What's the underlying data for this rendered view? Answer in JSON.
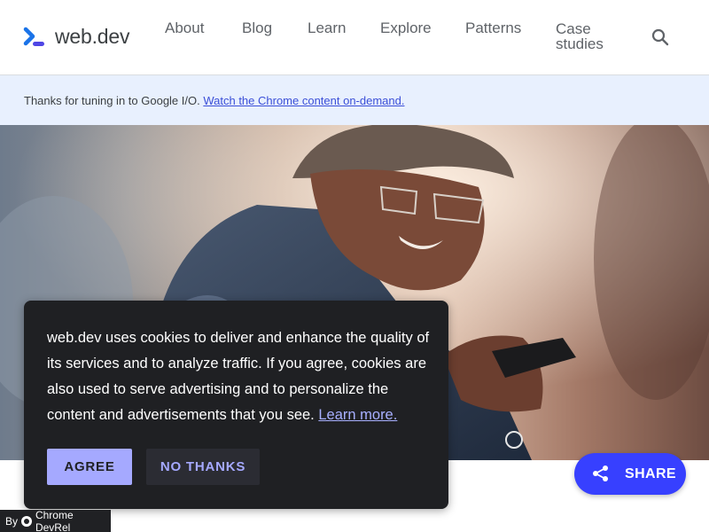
{
  "header": {
    "logo_text": "web.dev",
    "nav": [
      "About",
      "Blog",
      "Learn",
      "Explore",
      "Patterns"
    ],
    "nav_case_line1": "Case",
    "nav_case_line2": "studies",
    "search_icon": "search-icon"
  },
  "banner": {
    "text": "Thanks for tuning in to Google I/O. ",
    "link": "Watch the Chrome content on-demand."
  },
  "hero": {
    "image": "woman-smiling-at-phone-photo"
  },
  "cookie": {
    "text": "web.dev uses cookies to deliver and enhance the quality of its services and to analyze traffic. If you agree, cookies are also used to serve advertising and to personalize the content and advertisements that you see. ",
    "link": "Learn more.",
    "agree": "AGREE",
    "no_thanks": "NO THANKS"
  },
  "share": {
    "label": "SHARE",
    "icon": "share-icon"
  },
  "byline": {
    "prefix": "By",
    "author": "Chrome DevRel",
    "icon": "chrome-icon"
  },
  "colors": {
    "accent": "#3740ff",
    "banner_bg": "#e8f0fe",
    "dialog_bg": "#1f2023",
    "agree_bg": "#a5a9ff"
  }
}
